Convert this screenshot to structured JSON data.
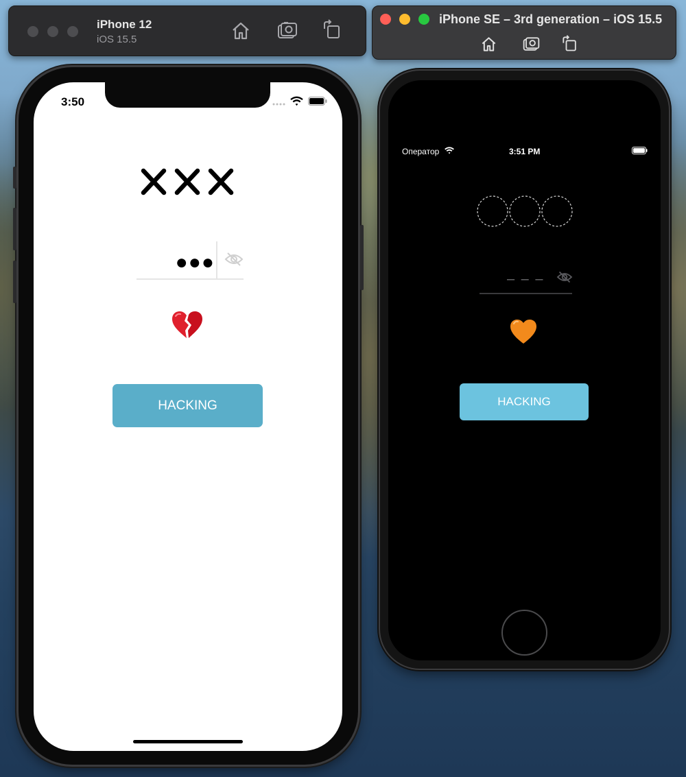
{
  "left_sim": {
    "title": "iPhone 12",
    "subtitle": "iOS 15.5",
    "toolbar_icons": [
      "home-icon",
      "screenshot-icon",
      "rotate-icon"
    ]
  },
  "right_sim": {
    "title": "iPhone SE – 3rd generation – iOS 15.5",
    "toolbar_icons": [
      "home-icon",
      "screenshot-icon",
      "rotate-icon"
    ],
    "colors": {
      "close": "#ff5f57",
      "minimize": "#febc2e",
      "zoom": "#28c840"
    }
  },
  "iphone12_app": {
    "status_time": "3:50",
    "progress_icon": "xxx-marks",
    "password_masked": "●●●",
    "password_toggle_icon": "eye-slash-icon",
    "status_emoji": "💔",
    "button_label": "HACKING",
    "button_color": "#5aaec9"
  },
  "iphonese_app": {
    "carrier": "Оператор",
    "status_time": "3:51 PM",
    "progress_icon": "dashed-circles",
    "password_placeholder": "– – –",
    "password_toggle_icon": "eye-slash-icon",
    "status_emoji": "🧡",
    "button_label": "HACKING",
    "button_color": "#6cc3df"
  }
}
